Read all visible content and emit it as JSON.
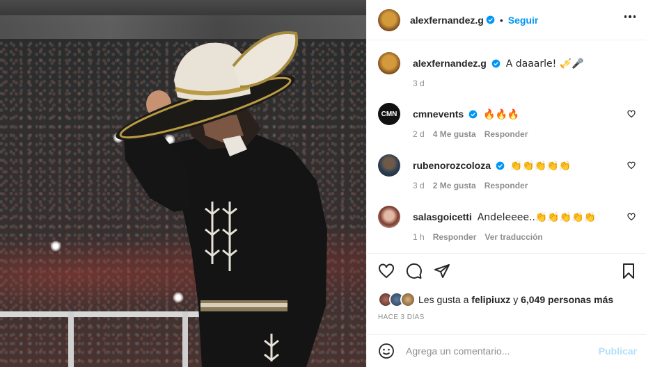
{
  "post": {
    "author": "alexfernandez.g",
    "follow_label": "Seguir",
    "separator": "•"
  },
  "caption": {
    "author": "alexfernandez.g",
    "text": "A daaarle! 🎺🎤",
    "time": "3 d"
  },
  "comments": [
    {
      "user": "cmnevents",
      "verified": true,
      "text": "🔥🔥🔥",
      "time": "2 d",
      "likes": "4 Me gusta",
      "reply": "Responder"
    },
    {
      "user": "rubenorozcoloza",
      "verified": true,
      "text": "👏👏👏👏👏",
      "time": "3 d",
      "likes": "2 Me gusta",
      "reply": "Responder"
    },
    {
      "user": "salasgoicetti",
      "verified": false,
      "text": "Andeleeee..👏👏👏👏👏",
      "time": "1 h",
      "reply": "Responder",
      "translate": "Ver traducción"
    }
  ],
  "likes": {
    "prefix": "Les gusta a",
    "user": "felipiuxz",
    "joiner": "y",
    "others": "6,049 personas más"
  },
  "posted_ago": "Hace 3 días",
  "composer": {
    "placeholder": "Agrega un comentario...",
    "publish_label": "Publicar"
  },
  "colors": {
    "accent": "#0095f6",
    "publish_disabled": "#b2dffc",
    "muted": "#8e8e8e",
    "text": "#262626"
  },
  "icons": [
    "verified-icon",
    "more-options-icon",
    "heart-icon",
    "comment-icon",
    "share-icon",
    "save-icon",
    "emoji-icon"
  ]
}
